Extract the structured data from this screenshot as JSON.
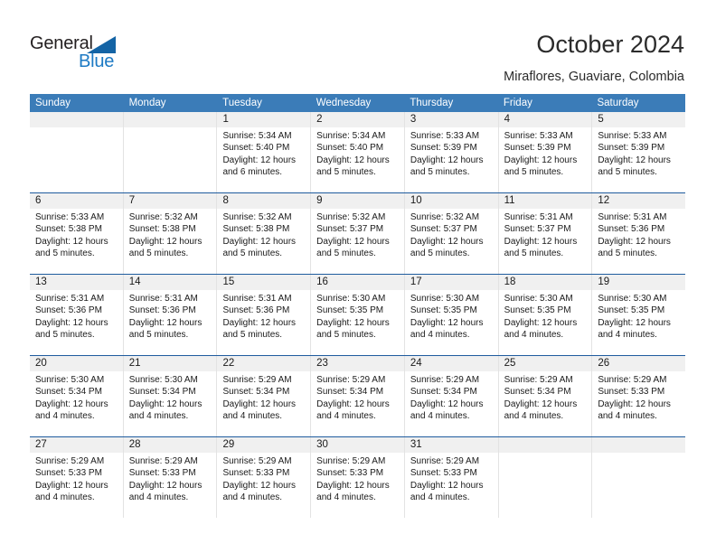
{
  "logo": {
    "word_one": "General",
    "word_two": "Blue",
    "triangle_color": "#1464a5",
    "blue_text_color": "#1d7ac4"
  },
  "header": {
    "title": "October 2024",
    "subtitle": "Miraflores, Guaviare, Colombia",
    "header_row_color": "#3b7cb8",
    "week_divider_color": "#1f5c9e",
    "daynum_band_color": "#f0f0f0"
  },
  "weekday_headers": [
    "Sunday",
    "Monday",
    "Tuesday",
    "Wednesday",
    "Thursday",
    "Friday",
    "Saturday"
  ],
  "weeks": [
    [
      {
        "day": "",
        "empty": true,
        "sunrise": "",
        "sunset": "",
        "daylight_line1": "",
        "daylight_line2": ""
      },
      {
        "day": "",
        "empty": true,
        "sunrise": "",
        "sunset": "",
        "daylight_line1": "",
        "daylight_line2": ""
      },
      {
        "day": "1",
        "sunrise": "Sunrise: 5:34 AM",
        "sunset": "Sunset: 5:40 PM",
        "daylight_line1": "Daylight: 12 hours",
        "daylight_line2": "and 6 minutes."
      },
      {
        "day": "2",
        "sunrise": "Sunrise: 5:34 AM",
        "sunset": "Sunset: 5:40 PM",
        "daylight_line1": "Daylight: 12 hours",
        "daylight_line2": "and 5 minutes."
      },
      {
        "day": "3",
        "sunrise": "Sunrise: 5:33 AM",
        "sunset": "Sunset: 5:39 PM",
        "daylight_line1": "Daylight: 12 hours",
        "daylight_line2": "and 5 minutes."
      },
      {
        "day": "4",
        "sunrise": "Sunrise: 5:33 AM",
        "sunset": "Sunset: 5:39 PM",
        "daylight_line1": "Daylight: 12 hours",
        "daylight_line2": "and 5 minutes."
      },
      {
        "day": "5",
        "sunrise": "Sunrise: 5:33 AM",
        "sunset": "Sunset: 5:39 PM",
        "daylight_line1": "Daylight: 12 hours",
        "daylight_line2": "and 5 minutes."
      }
    ],
    [
      {
        "day": "6",
        "sunrise": "Sunrise: 5:33 AM",
        "sunset": "Sunset: 5:38 PM",
        "daylight_line1": "Daylight: 12 hours",
        "daylight_line2": "and 5 minutes."
      },
      {
        "day": "7",
        "sunrise": "Sunrise: 5:32 AM",
        "sunset": "Sunset: 5:38 PM",
        "daylight_line1": "Daylight: 12 hours",
        "daylight_line2": "and 5 minutes."
      },
      {
        "day": "8",
        "sunrise": "Sunrise: 5:32 AM",
        "sunset": "Sunset: 5:38 PM",
        "daylight_line1": "Daylight: 12 hours",
        "daylight_line2": "and 5 minutes."
      },
      {
        "day": "9",
        "sunrise": "Sunrise: 5:32 AM",
        "sunset": "Sunset: 5:37 PM",
        "daylight_line1": "Daylight: 12 hours",
        "daylight_line2": "and 5 minutes."
      },
      {
        "day": "10",
        "sunrise": "Sunrise: 5:32 AM",
        "sunset": "Sunset: 5:37 PM",
        "daylight_line1": "Daylight: 12 hours",
        "daylight_line2": "and 5 minutes."
      },
      {
        "day": "11",
        "sunrise": "Sunrise: 5:31 AM",
        "sunset": "Sunset: 5:37 PM",
        "daylight_line1": "Daylight: 12 hours",
        "daylight_line2": "and 5 minutes."
      },
      {
        "day": "12",
        "sunrise": "Sunrise: 5:31 AM",
        "sunset": "Sunset: 5:36 PM",
        "daylight_line1": "Daylight: 12 hours",
        "daylight_line2": "and 5 minutes."
      }
    ],
    [
      {
        "day": "13",
        "sunrise": "Sunrise: 5:31 AM",
        "sunset": "Sunset: 5:36 PM",
        "daylight_line1": "Daylight: 12 hours",
        "daylight_line2": "and 5 minutes."
      },
      {
        "day": "14",
        "sunrise": "Sunrise: 5:31 AM",
        "sunset": "Sunset: 5:36 PM",
        "daylight_line1": "Daylight: 12 hours",
        "daylight_line2": "and 5 minutes."
      },
      {
        "day": "15",
        "sunrise": "Sunrise: 5:31 AM",
        "sunset": "Sunset: 5:36 PM",
        "daylight_line1": "Daylight: 12 hours",
        "daylight_line2": "and 5 minutes."
      },
      {
        "day": "16",
        "sunrise": "Sunrise: 5:30 AM",
        "sunset": "Sunset: 5:35 PM",
        "daylight_line1": "Daylight: 12 hours",
        "daylight_line2": "and 5 minutes."
      },
      {
        "day": "17",
        "sunrise": "Sunrise: 5:30 AM",
        "sunset": "Sunset: 5:35 PM",
        "daylight_line1": "Daylight: 12 hours",
        "daylight_line2": "and 4 minutes."
      },
      {
        "day": "18",
        "sunrise": "Sunrise: 5:30 AM",
        "sunset": "Sunset: 5:35 PM",
        "daylight_line1": "Daylight: 12 hours",
        "daylight_line2": "and 4 minutes."
      },
      {
        "day": "19",
        "sunrise": "Sunrise: 5:30 AM",
        "sunset": "Sunset: 5:35 PM",
        "daylight_line1": "Daylight: 12 hours",
        "daylight_line2": "and 4 minutes."
      }
    ],
    [
      {
        "day": "20",
        "sunrise": "Sunrise: 5:30 AM",
        "sunset": "Sunset: 5:34 PM",
        "daylight_line1": "Daylight: 12 hours",
        "daylight_line2": "and 4 minutes."
      },
      {
        "day": "21",
        "sunrise": "Sunrise: 5:30 AM",
        "sunset": "Sunset: 5:34 PM",
        "daylight_line1": "Daylight: 12 hours",
        "daylight_line2": "and 4 minutes."
      },
      {
        "day": "22",
        "sunrise": "Sunrise: 5:29 AM",
        "sunset": "Sunset: 5:34 PM",
        "daylight_line1": "Daylight: 12 hours",
        "daylight_line2": "and 4 minutes."
      },
      {
        "day": "23",
        "sunrise": "Sunrise: 5:29 AM",
        "sunset": "Sunset: 5:34 PM",
        "daylight_line1": "Daylight: 12 hours",
        "daylight_line2": "and 4 minutes."
      },
      {
        "day": "24",
        "sunrise": "Sunrise: 5:29 AM",
        "sunset": "Sunset: 5:34 PM",
        "daylight_line1": "Daylight: 12 hours",
        "daylight_line2": "and 4 minutes."
      },
      {
        "day": "25",
        "sunrise": "Sunrise: 5:29 AM",
        "sunset": "Sunset: 5:34 PM",
        "daylight_line1": "Daylight: 12 hours",
        "daylight_line2": "and 4 minutes."
      },
      {
        "day": "26",
        "sunrise": "Sunrise: 5:29 AM",
        "sunset": "Sunset: 5:33 PM",
        "daylight_line1": "Daylight: 12 hours",
        "daylight_line2": "and 4 minutes."
      }
    ],
    [
      {
        "day": "27",
        "sunrise": "Sunrise: 5:29 AM",
        "sunset": "Sunset: 5:33 PM",
        "daylight_line1": "Daylight: 12 hours",
        "daylight_line2": "and 4 minutes."
      },
      {
        "day": "28",
        "sunrise": "Sunrise: 5:29 AM",
        "sunset": "Sunset: 5:33 PM",
        "daylight_line1": "Daylight: 12 hours",
        "daylight_line2": "and 4 minutes."
      },
      {
        "day": "29",
        "sunrise": "Sunrise: 5:29 AM",
        "sunset": "Sunset: 5:33 PM",
        "daylight_line1": "Daylight: 12 hours",
        "daylight_line2": "and 4 minutes."
      },
      {
        "day": "30",
        "sunrise": "Sunrise: 5:29 AM",
        "sunset": "Sunset: 5:33 PM",
        "daylight_line1": "Daylight: 12 hours",
        "daylight_line2": "and 4 minutes."
      },
      {
        "day": "31",
        "sunrise": "Sunrise: 5:29 AM",
        "sunset": "Sunset: 5:33 PM",
        "daylight_line1": "Daylight: 12 hours",
        "daylight_line2": "and 4 minutes."
      },
      {
        "day": "",
        "empty": true,
        "sunrise": "",
        "sunset": "",
        "daylight_line1": "",
        "daylight_line2": ""
      },
      {
        "day": "",
        "empty": true,
        "sunrise": "",
        "sunset": "",
        "daylight_line1": "",
        "daylight_line2": ""
      }
    ]
  ]
}
